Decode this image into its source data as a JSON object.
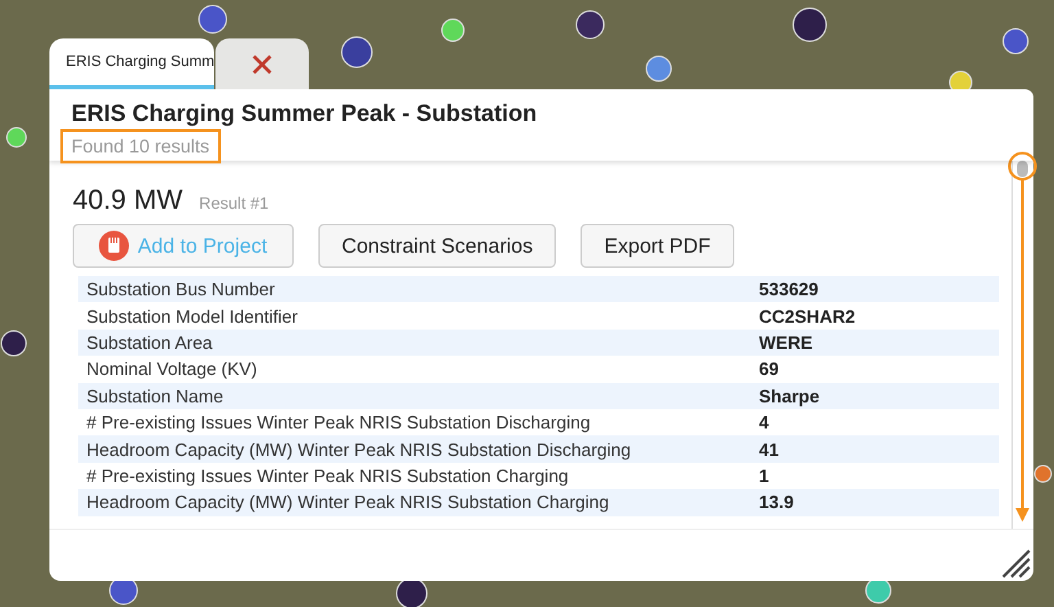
{
  "tabs": [
    {
      "label": "ERIS Charging Summ",
      "selected": true
    }
  ],
  "panel": {
    "title": "ERIS Charging Summer Peak - Substation",
    "result_count": "Found 10 results"
  },
  "result": {
    "value": "40.9 MW",
    "label": "Result #1"
  },
  "buttons": [
    {
      "kind": "project",
      "label": "Add to Project"
    },
    {
      "kind": "plain",
      "label": "Constraint Scenarios"
    },
    {
      "kind": "plain",
      "label": "Export PDF"
    }
  ],
  "table": {
    "rows": [
      {
        "label": "Substation Bus Number",
        "value": "533629"
      },
      {
        "label": "Substation Model Identifier",
        "value": "CC2SHAR2"
      },
      {
        "label": "Substation Area",
        "value": "WERE"
      },
      {
        "label": "Nominal Voltage (KV)",
        "value": "69"
      },
      {
        "label": "Substation Name",
        "value": "Sharpe"
      },
      {
        "label": "# Pre-existing Issues Winter Peak NRIS Substation Discharging",
        "value": "4"
      },
      {
        "label": "Headroom Capacity (MW) Winter Peak NRIS Substation Discharging",
        "value": "41"
      },
      {
        "label": "# Pre-existing Issues Winter Peak NRIS Substation Charging",
        "value": "1"
      },
      {
        "label": "Headroom Capacity (MW) Winter Peak NRIS Substation Charging",
        "value": "13.9"
      }
    ]
  }
}
